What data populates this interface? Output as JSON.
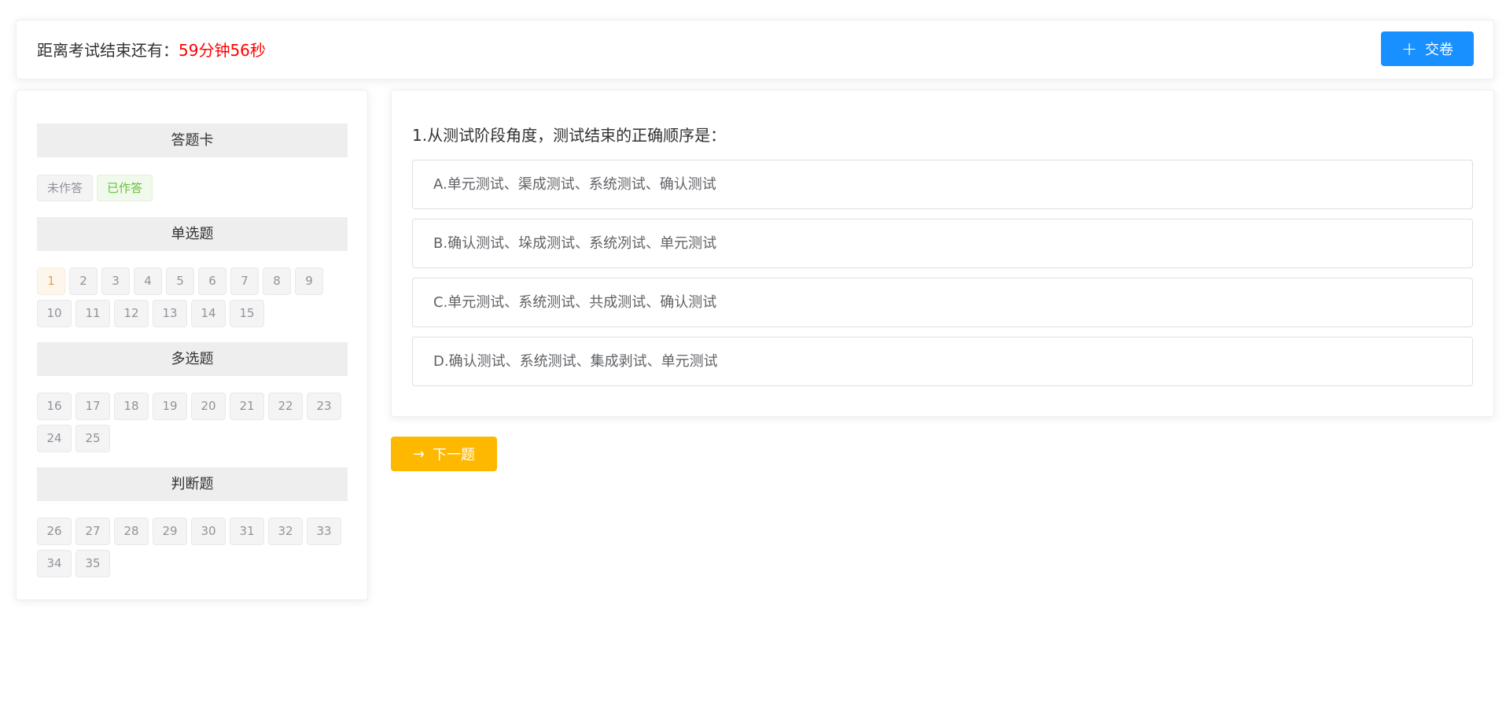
{
  "header": {
    "timer_label": "距离考试结束还有：",
    "timer_value": "59分钟56秒",
    "submit_label": "交卷"
  },
  "sidebar": {
    "title": "答题卡",
    "legend": {
      "unanswered": "未作答",
      "answered": "已作答"
    },
    "single": {
      "title": "单选题",
      "numbers": [
        "1",
        "2",
        "3",
        "4",
        "5",
        "6",
        "7",
        "8",
        "9",
        "10",
        "11",
        "12",
        "13",
        "14",
        "15"
      ]
    },
    "multiple": {
      "title": "多选题",
      "numbers": [
        "16",
        "17",
        "18",
        "19",
        "20",
        "21",
        "22",
        "23",
        "24",
        "25"
      ]
    },
    "judge": {
      "title": "判断题",
      "numbers": [
        "26",
        "27",
        "28",
        "29",
        "30",
        "31",
        "32",
        "33",
        "34",
        "35"
      ]
    },
    "current": "1"
  },
  "question": {
    "text": "1.从测试阶段角度，测试结束的正确顺序是：",
    "options": [
      "A.单元测试、渠成测试、系统测试、确认测试",
      "B.确认测试、垛成测试、系统冽试、单元测试",
      "C.单元测试、系统测试、共成测试、确认测试",
      "D.确认测试、系统测试、集成剥试、单元测试"
    ]
  },
  "next_label": "下一题",
  "colors": {
    "primary": "#1890ff",
    "warning": "#ffb800",
    "timer": "#ff0000"
  }
}
